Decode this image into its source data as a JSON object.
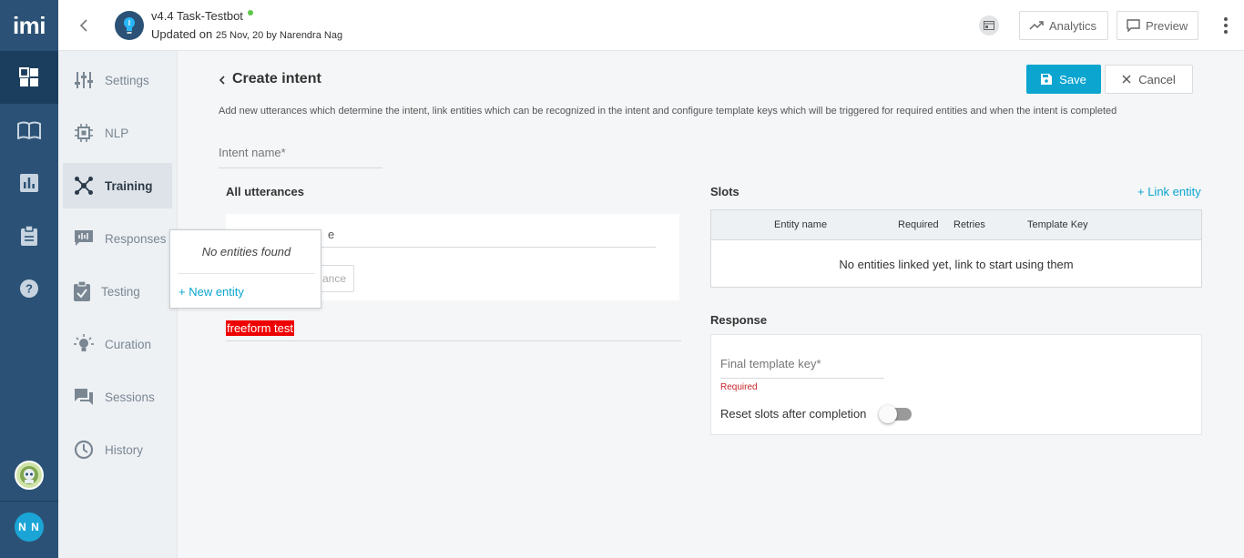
{
  "rail": {
    "logo": "imi",
    "user_initials": "N N"
  },
  "topbar": {
    "bot_title": "v4.4 Task-Testbot",
    "updated_prefix": "Updated on",
    "updated_detail": "25 Nov, 20 by Narendra Nag",
    "analytics_label": "Analytics",
    "preview_label": "Preview"
  },
  "subnav": {
    "items": [
      {
        "label": "Settings",
        "icon": "settings-sliders-icon"
      },
      {
        "label": "NLP",
        "icon": "chip-icon"
      },
      {
        "label": "Training",
        "icon": "network-icon"
      },
      {
        "label": "Responses",
        "icon": "chat-wave-icon"
      },
      {
        "label": "Testing",
        "icon": "clipboard-check-icon"
      },
      {
        "label": "Curation",
        "icon": "lightbulb-icon"
      },
      {
        "label": "Sessions",
        "icon": "chat-bubbles-icon"
      },
      {
        "label": "History",
        "icon": "history-icon"
      }
    ],
    "active": "Training"
  },
  "page": {
    "title": "Create intent",
    "save_label": "Save",
    "cancel_label": "Cancel",
    "description": "Add new utterances which determine the intent, link entities which can be recognized in the intent and configure template keys which will be triggered for required entities and when the intent is completed",
    "intent_placeholder": "Intent name*"
  },
  "utterances": {
    "heading": "All utterances",
    "input_partial": "e",
    "button_partial": "ance",
    "highlighted_text": "freeform test"
  },
  "entity_dropdown": {
    "empty_text": "No entities found",
    "new_entity_label": "+ New entity"
  },
  "slots": {
    "heading": "Slots",
    "link_label": "+ Link entity",
    "columns": [
      "Entity name",
      "Required",
      "Retries",
      "Template Key"
    ],
    "empty_text": "No entities linked yet, link to start using them"
  },
  "response": {
    "heading": "Response",
    "template_placeholder": "Final template key*",
    "required_msg": "Required",
    "reset_label": "Reset slots after completion",
    "reset_enabled": false
  },
  "colors": {
    "accent": "#0ba5d0",
    "rail": "#2b5276",
    "highlight": "#ee0000",
    "error": "#c9242b"
  }
}
